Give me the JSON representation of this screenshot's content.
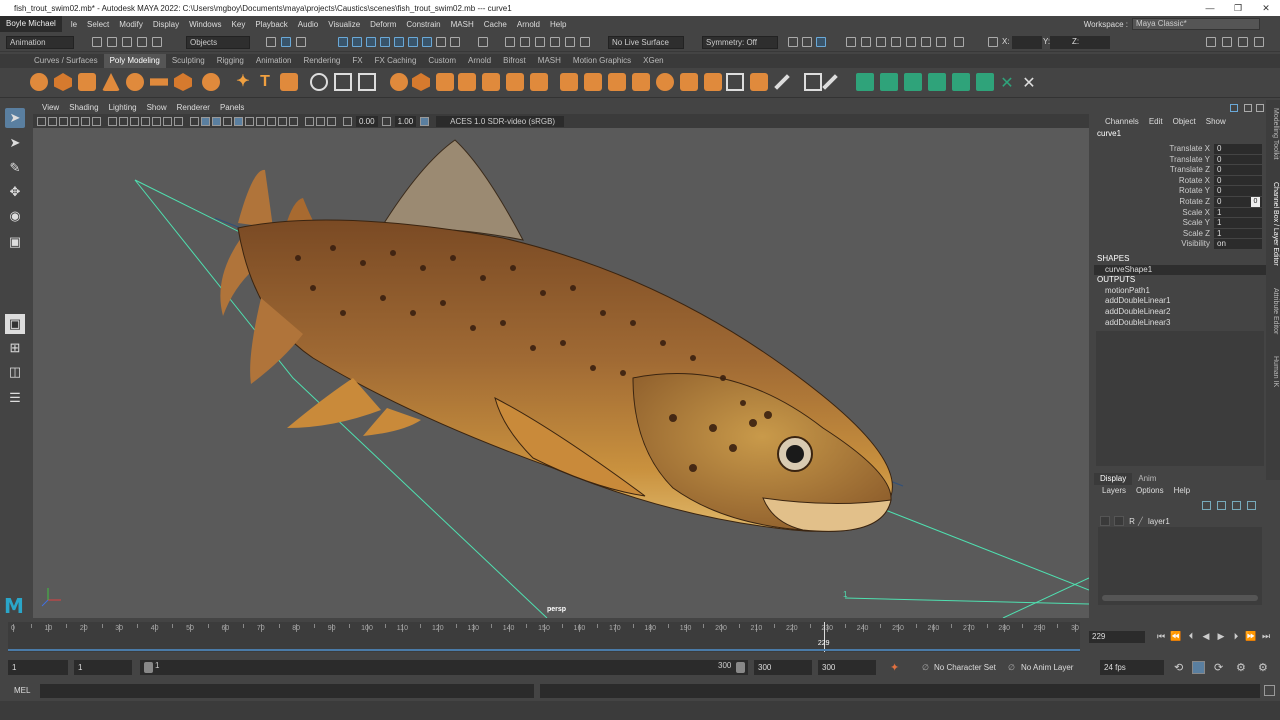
{
  "titlebar": {
    "title": "fish_trout_swim02.mb* - Autodesk MAYA 2022: C:\\Users\\mgboy\\Documents\\maya\\projects\\Caustics\\scenes\\fish_trout_swim02.mb  ---  curve1",
    "min": "—",
    "max": "❐",
    "close": "✕"
  },
  "menubar": {
    "user": "Boyle Michael",
    "items": [
      "le",
      "Select",
      "Modify",
      "Display",
      "Windows",
      "Key",
      "Playback",
      "Audio",
      "Visualize",
      "Deform",
      "Constrain",
      "MASH",
      "Cache",
      "Arnold",
      "Help"
    ],
    "workspace_label": "Workspace :",
    "workspace_value": "Maya Classic*"
  },
  "statusline": {
    "mode": "Animation",
    "objects": "Objects",
    "live_surface": "No Live Surface",
    "symmetry": "Symmetry: Off",
    "x": "X:",
    "y": "Y:",
    "z": "Z:"
  },
  "shelf_tabs": [
    "Curves / Surfaces",
    "Poly Modeling",
    "Sculpting",
    "Rigging",
    "Animation",
    "Rendering",
    "FX",
    "FX Caching",
    "Custom",
    "Arnold",
    "Bifrost",
    "MASH",
    "Motion Graphics",
    "XGen"
  ],
  "panel": {
    "menus": [
      "View",
      "Shading",
      "Lighting",
      "Show",
      "Renderer",
      "Panels"
    ],
    "exposure": "0.00",
    "gamma": "1.00",
    "colorspace": "ACES 1.0 SDR-video (sRGB)",
    "camera": "persp",
    "path_marker": "1"
  },
  "channelbox": {
    "menus": [
      "Channels",
      "Edit",
      "Object",
      "Show"
    ],
    "object": "curve1",
    "attributes": [
      {
        "name": "Translate X",
        "value": "0"
      },
      {
        "name": "Translate Y",
        "value": "0"
      },
      {
        "name": "Translate Z",
        "value": "0"
      },
      {
        "name": "Rotate X",
        "value": "0"
      },
      {
        "name": "Rotate Y",
        "value": "0"
      },
      {
        "name": "Rotate Z",
        "value": "0"
      },
      {
        "name": "Scale X",
        "value": "1"
      },
      {
        "name": "Scale Y",
        "value": "1"
      },
      {
        "name": "Scale Z",
        "value": "1"
      },
      {
        "name": "Visibility",
        "value": "on"
      }
    ],
    "rotate_z_key": "0",
    "shapes_label": "SHAPES",
    "shapes": [
      "curveShape1"
    ],
    "outputs_label": "OUTPUTS",
    "outputs": [
      "motionPath1",
      "addDoubleLinear1",
      "addDoubleLinear2",
      "addDoubleLinear3"
    ]
  },
  "side_tabs": [
    "Modelling Toolkit",
    "Channel Box / Layer Editor",
    "Attribute Editor",
    "Human IK"
  ],
  "layer_editor": {
    "tabs": [
      "Display",
      "Anim"
    ],
    "menus": [
      "Layers",
      "Options",
      "Help"
    ],
    "layer_flag": "R",
    "layer_name": "layer1"
  },
  "timeline": {
    "start": 0,
    "end": 300,
    "ticks": [
      "0",
      "10",
      "20",
      "30",
      "40",
      "50",
      "60",
      "70",
      "80",
      "90",
      "100",
      "110",
      "120",
      "130",
      "140",
      "150",
      "160",
      "170",
      "180",
      "190",
      "200",
      "210",
      "220",
      "230",
      "240",
      "250",
      "260",
      "270",
      "280",
      "290",
      "30"
    ],
    "current_frame": "229",
    "current_field": "229"
  },
  "range": {
    "start": "1",
    "start2": "1",
    "slider_start": "1",
    "slider_end": "300",
    "end": "300",
    "end2": "300",
    "character_set": "No Character Set",
    "anim_layer": "No Anim Layer",
    "fps": "24 fps"
  },
  "cmdline": {
    "label": "MEL"
  },
  "colors": {
    "accent": "#5a7fa0",
    "curve": "#4fe0b0",
    "shelf_icon": "#e08a3c",
    "maya_logo": "#2aa6c9"
  }
}
